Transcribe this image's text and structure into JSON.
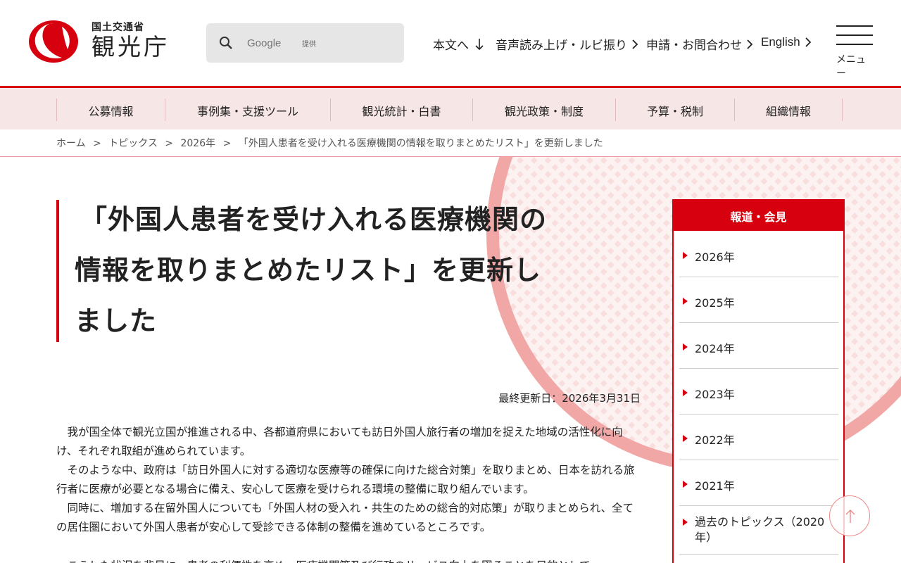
{
  "header": {
    "ministry": "国土交通省",
    "agency": "観光庁",
    "search_placeholder": "Google",
    "search_provided": "提供",
    "utility_links": [
      "本文へ",
      "音声読み上げ・ルビ振り",
      "申請・お問合わせ",
      "English"
    ],
    "menu_label": "メニュー"
  },
  "nav": {
    "items": [
      "公募情報",
      "事例集・支援ツール",
      "観光統計・白書",
      "観光政策・制度",
      "予算・税制",
      "組織情報"
    ]
  },
  "breadcrumb": {
    "items": [
      "ホーム",
      ">",
      "トピックス",
      ">",
      "2026年",
      ">",
      "「外国人患者を受け入れる医療機関の情報を取りまとめたリスト」を更新しました"
    ]
  },
  "article": {
    "title_lines": [
      "「外国人患者を受け入れる医療機関の",
      "情報を取りまとめたリスト」を更新し",
      "ました"
    ],
    "updated": "最終更新日：2026年3月31日",
    "paragraphs": [
      "我が国全体で観光立国が推進される中、各都道府県においても訪日外国人旅行者の増加を捉えた地域の活性化に向け、それぞれ取組が進められています。",
      "そのような中、政府は「訪日外国人に対する適切な医療等の確保に向けた総合対策」を取りまとめ、日本を訪れる旅行者に医療が必要となる場合に備え、安心して医療を受けられる環境の整備に取り組んでいます。",
      "同時に、増加する在留外国人についても「外国人材の受入れ・共生のための総合的対応策」が取りまとめられ、全ての居住圏において外国人患者が安心して受診できる体制の整備を進めているところです。",
      "こうした状況を背景に、患者の利便性を高め、医療機関等及び行政のサービス向上を図ることを目的として"
    ]
  },
  "sidebar": {
    "heading": "報道・会見",
    "items": [
      "2026年",
      "2025年",
      "2024年",
      "2023年",
      "2022年",
      "2021年",
      "過去のトピックス（2020年）"
    ]
  },
  "colors": {
    "brand_red": "#d7000f",
    "nav_bg": "#f7e6e6"
  }
}
